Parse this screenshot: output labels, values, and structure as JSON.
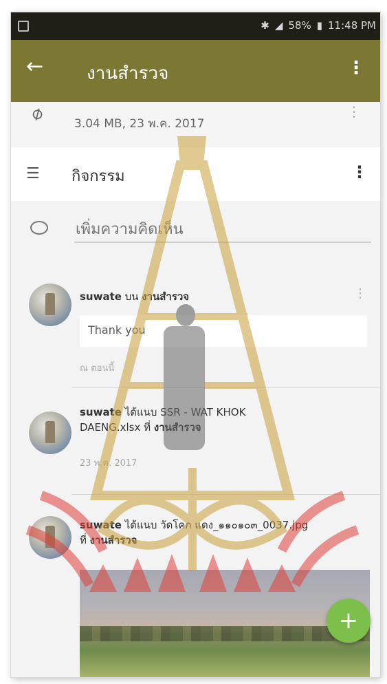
{
  "status_bar": {
    "battery": "58%",
    "time": "11:48 PM"
  },
  "app_bar": {
    "title": "งานสำรวจ"
  },
  "attachment": {
    "meta": "3.04 MB, 23 พ.ค. 2017"
  },
  "activity": {
    "label": "กิจกรรม"
  },
  "comment_input": {
    "placeholder": "เพิ่มความคิดเห็น"
  },
  "feed": [
    {
      "user": "suwate",
      "action": " บน ",
      "target": "งานสำรวจ",
      "comment": "Thank you",
      "time": "ณ ตอนนี้"
    },
    {
      "user": "suwate",
      "action": " ได้แนบ SSR - WAT KHOK DAENG.xlsx ที่ ",
      "target": "งานสำรวจ",
      "time": "23 พ.ค. 2017"
    },
    {
      "user": "suwate",
      "action": " ได้แนบ วัดโคก แดง_๑๑๐๑๐๓_0037.jpg ที่ ",
      "target": "งานสำรวจ"
    }
  ],
  "fab": {
    "label": "+"
  },
  "colors": {
    "app_bar": "#7c7834",
    "fab": "#7cc04b",
    "watermark_red": "#e0413a",
    "watermark_gold": "#c9a03a"
  }
}
